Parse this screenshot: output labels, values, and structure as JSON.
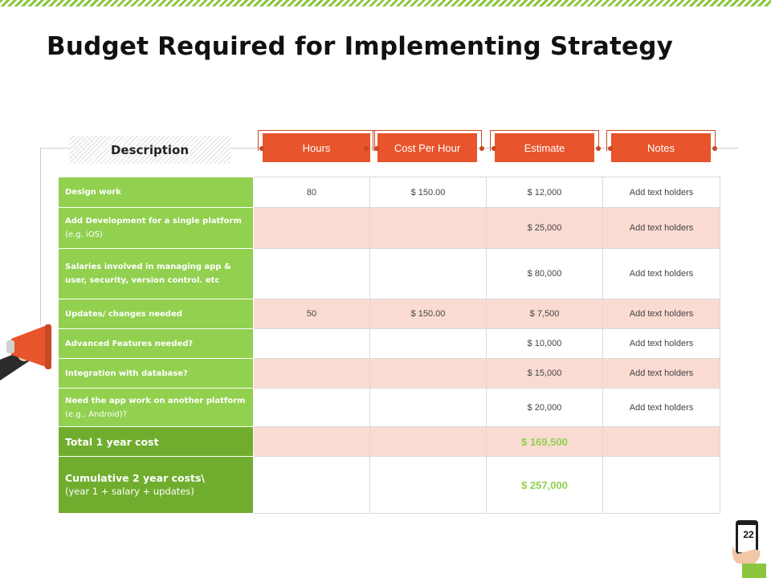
{
  "title": "Budget Required for Implementing Strategy",
  "description_label": "Description",
  "columns": [
    "Hours",
    "Cost Per Hour",
    "Estimate",
    "Notes"
  ],
  "rows": [
    {
      "label": "Design work",
      "sub": "",
      "hours": "80",
      "cost": "$ 150.00",
      "estimate": "$ 12,000",
      "notes": "Add text holders"
    },
    {
      "label": "Add Development for a single platform",
      "sub": "(e.g. iOS)",
      "hours": "",
      "cost": "",
      "estimate": "$ 25,000",
      "notes": "Add text holders"
    },
    {
      "label": "Salaries involved in managing app & user, security, version control. etc",
      "sub": "",
      "hours": "",
      "cost": "",
      "estimate": "$ 80,000",
      "notes": "Add text holders"
    },
    {
      "label": "Updates/ changes needed",
      "sub": "",
      "hours": "50",
      "cost": "$ 150.00",
      "estimate": "$ 7,500",
      "notes": "Add text holders"
    },
    {
      "label": "Advanced Features needed?",
      "sub": "",
      "hours": "",
      "cost": "",
      "estimate": "$ 10,000",
      "notes": "Add text holders"
    },
    {
      "label": "Integration with database?",
      "sub": "",
      "hours": "",
      "cost": "",
      "estimate": "$ 15,000",
      "notes": "Add text holders"
    },
    {
      "label": "Need the app work on another platform",
      "sub": "(e.g., Android)?",
      "hours": "",
      "cost": "",
      "estimate": "$ 20,000",
      "notes": "Add text holders"
    }
  ],
  "totals": [
    {
      "label": "Total 1 year cost",
      "sub": "",
      "estimate": "$ 169,500"
    },
    {
      "label": "Cumulative 2 year costs\\",
      "sub": "(year 1 + salary + updates)",
      "estimate": "$ 257,000"
    }
  ],
  "page_number": "22",
  "colors": {
    "green": "#92d050",
    "dark_green": "#70ad2e",
    "orange": "#e8542b",
    "pink": "#fadbd2"
  },
  "icons": [
    "megaphone-icon",
    "phone-in-hand-icon"
  ]
}
